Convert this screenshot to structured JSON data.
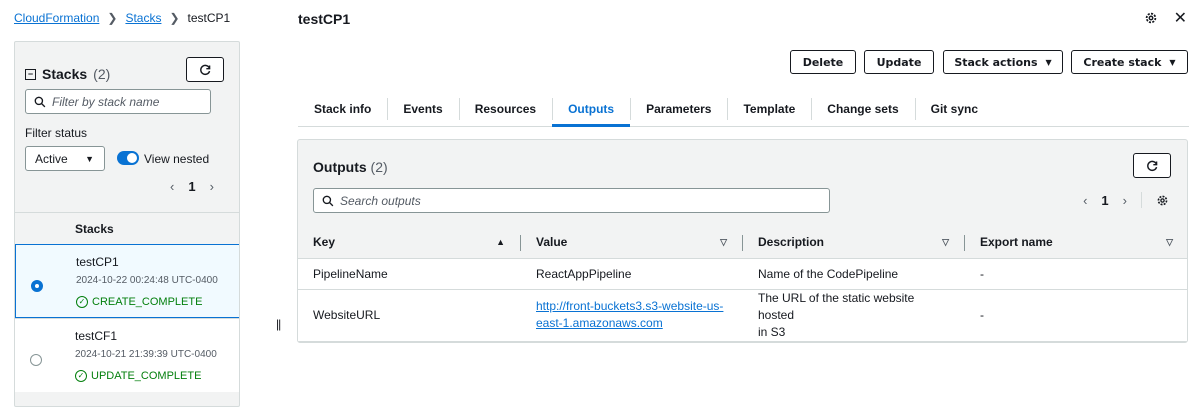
{
  "breadcrumb": {
    "root": "CloudFormation",
    "stacks": "Stacks",
    "current": "testCP1"
  },
  "sidebar": {
    "title": "Stacks",
    "count": "(2)",
    "filter_placeholder": "Filter by stack name",
    "filter_status_label": "Filter status",
    "status_value": "Active",
    "view_nested_label": "View nested",
    "view_nested_on": true,
    "page": "1",
    "column_header": "Stacks",
    "stacks": [
      {
        "name": "testCP1",
        "date": "2024-10-22 00:24:48 UTC-0400",
        "status": "CREATE_COMPLETE",
        "selected": true
      },
      {
        "name": "testCF1",
        "date": "2024-10-21 21:39:39 UTC-0400",
        "status": "UPDATE_COMPLETE",
        "selected": false
      }
    ]
  },
  "header": {
    "title": "testCP1"
  },
  "actions": {
    "delete": "Delete",
    "update": "Update",
    "stack_actions": "Stack actions",
    "create_stack": "Create stack"
  },
  "tabs": [
    {
      "label": "Stack info"
    },
    {
      "label": "Events"
    },
    {
      "label": "Resources"
    },
    {
      "label": "Outputs",
      "active": true
    },
    {
      "label": "Parameters"
    },
    {
      "label": "Template"
    },
    {
      "label": "Change sets"
    },
    {
      "label": "Git sync"
    }
  ],
  "outputs": {
    "title": "Outputs",
    "count": "(2)",
    "search_placeholder": "Search outputs",
    "page": "1",
    "columns": {
      "key": "Key",
      "value": "Value",
      "description": "Description",
      "export": "Export name"
    },
    "rows": [
      {
        "key": "PipelineName",
        "value": "ReactAppPipeline",
        "value_is_link": false,
        "description": "Name of the CodePipeline",
        "export": "-"
      },
      {
        "key": "WebsiteURL",
        "value_line1": "http://front-buckets3.s3-website-us-",
        "value_line2": "east-1.amazonaws.com",
        "value_is_link": true,
        "description_line1": "The URL of the static website hosted",
        "description_line2": "in S3",
        "export": "-"
      }
    ]
  },
  "colors": {
    "accent": "#0972d3",
    "success": "#037f0c",
    "panel_bg": "#f2f3f3"
  }
}
